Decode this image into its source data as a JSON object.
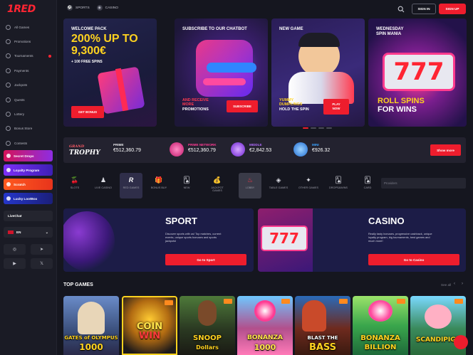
{
  "brand": {
    "logo": "1RED",
    "accent": "#ee1d2d"
  },
  "sidebar": {
    "items": [
      {
        "label": "All Games",
        "icon": "grid-icon"
      },
      {
        "label": "Promotions",
        "icon": "gift-icon"
      },
      {
        "label": "Tournaments",
        "icon": "trophy-icon",
        "badge": true
      },
      {
        "label": "Payments",
        "icon": "wallet-icon"
      },
      {
        "label": "Jackpots",
        "icon": "jackpot-icon"
      },
      {
        "label": "Quests",
        "icon": "quest-icon"
      },
      {
        "label": "Lottery",
        "icon": "ticket-icon"
      },
      {
        "label": "Bonus Store",
        "icon": "store-icon"
      },
      {
        "label": "Contests",
        "icon": "medal-icon"
      }
    ],
    "promos": [
      "Secret Drops",
      "Loyalty Program",
      "Scratch",
      "Lucky LootBox"
    ],
    "live_chat": "LiveChat",
    "language": "EN"
  },
  "header": {
    "tabs": [
      "SPORTS",
      "CASINO"
    ],
    "sign_in": "SIGN IN",
    "sign_up": "SIGN UP"
  },
  "banners": [
    {
      "caption": "WELCOME PACK",
      "headline1": "200% UP TO",
      "headline2": "9,300€",
      "sub": "+ 100 FREE SPINS",
      "button": "GET BONUS"
    },
    {
      "caption": "SUBSCRIBE TO OUR CHATBOT",
      "body": [
        "AND RECEIVE",
        "MORE",
        "PROMOTIONS"
      ],
      "button": "SUBSCRIBE"
    },
    {
      "caption": "NEW GAME",
      "body": [
        "YUMMY",
        "DUMPLINGS",
        "HOLD THE SPIN"
      ],
      "button": [
        "PLAY",
        "NOW"
      ]
    },
    {
      "caption": [
        "WEDNESDAY",
        "SPIN MANIA"
      ],
      "body": [
        "ROLL SPINS",
        "FOR WINS"
      ],
      "reels": "777"
    }
  ],
  "jackpots": {
    "logo_top": "GRAND",
    "logo_bottom": "TROPHY",
    "items": [
      {
        "label": "PRIME",
        "value": "€512,360.79",
        "color": "#ffffff"
      },
      {
        "label": "PRIME NETWORK",
        "value": "€512,360.79",
        "color": "#ff3b93"
      },
      {
        "label": "MIDDLE",
        "value": "€2,842.53",
        "color": "#b26bff"
      },
      {
        "label": "MINI",
        "value": "€926.32",
        "color": "#3ba3ff"
      }
    ],
    "show_more": "Show more"
  },
  "categories": [
    {
      "label": "SLOTS",
      "icon": "cherry-icon"
    },
    {
      "label": "LIVE CASINO",
      "icon": "dealer-icon"
    },
    {
      "label": "RED GAMES",
      "icon": "red-logo-icon"
    },
    {
      "label": "BONUS BUY",
      "icon": "gift-icon"
    },
    {
      "label": "NEW",
      "icon": "cards-icon"
    },
    {
      "label": "JACKPOT GAMES",
      "icon": "moneybag-icon"
    },
    {
      "label": "LOBBY",
      "icon": "flame-icon"
    },
    {
      "label": "TABLE GAMES",
      "icon": "chip-icon"
    },
    {
      "label": "OTHER GAMES",
      "icon": "lamp-icon"
    },
    {
      "label": "DROPS&WINS",
      "icon": "cards-icon"
    },
    {
      "label": "CARD",
      "icon": "cards-icon"
    }
  ],
  "providers_placeholder": "Providers",
  "promo_cards": [
    {
      "title": "SPORT",
      "text": [
        "Discover sports with us! Top matches, current",
        "events, unique sports bonuses and sports",
        "jackpots!"
      ],
      "button": "Go to Sport"
    },
    {
      "title": "CASINO",
      "text": [
        "Really tasty bonuses, progressive cashback, unique",
        "loyalty program, big tournaments, best games and",
        "much more!"
      ],
      "button": "Go to Casino",
      "reels": "777"
    }
  ],
  "top_games": {
    "title": "TOP GAMES",
    "see_all": "See all",
    "games": [
      {
        "name": [
          "GATES of OLYMPUS",
          "1000"
        ],
        "bg": "#3a4e7a"
      },
      {
        "name": [
          "COIN",
          "WIN"
        ],
        "bg": "#7a4a10"
      },
      {
        "name": [
          "SNOOP",
          "Dollars"
        ],
        "bg": "#2b3a22"
      },
      {
        "name": [
          "BONANZA",
          "1000"
        ],
        "bg": "#b24f8c"
      },
      {
        "name": [
          "BLAST THE",
          "BASS"
        ],
        "bg": "#6e2a1e"
      },
      {
        "name": [
          "BONANZA",
          "BILLION"
        ],
        "bg": "#3aa64c"
      },
      {
        "name": [
          "SCANDIPIGS"
        ],
        "bg": "#3a8a5c"
      }
    ]
  }
}
